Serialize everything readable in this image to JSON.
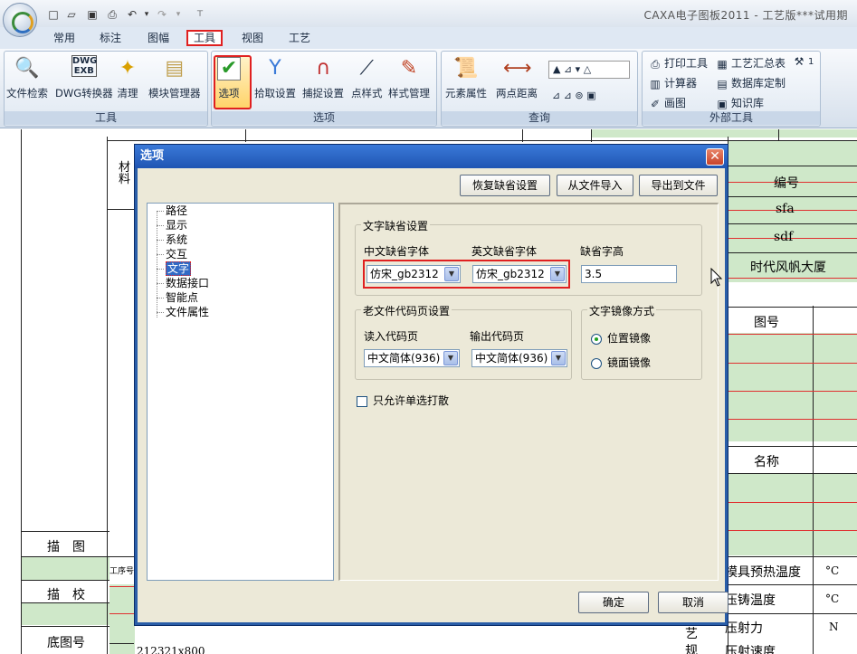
{
  "app": {
    "title": "CAXA电子图板2011 - 工艺版***试用期",
    "quick_access": [
      "□",
      "▱",
      "▣",
      "⎙",
      "↶",
      "▾",
      "↷",
      "▾",
      "⊤"
    ]
  },
  "ribbon_tabs": [
    "常用",
    "标注",
    "图幅",
    "工具",
    "视图",
    "工艺"
  ],
  "groups": {
    "tools": {
      "label": "工具",
      "buttons": [
        {
          "label": "文件检索",
          "icon": "search-icon"
        },
        {
          "label": "DWG转换器",
          "icon": "dwg-converter-icon"
        },
        {
          "label": "清理",
          "icon": "clean-icon"
        },
        {
          "label": "模块管理器",
          "icon": "module-manager-icon"
        }
      ]
    },
    "options": {
      "label": "选项",
      "buttons": [
        {
          "label": "选项",
          "icon": "checkmark-icon"
        },
        {
          "label": "拾取设置",
          "icon": "pick-icon"
        },
        {
          "label": "捕捉设置",
          "icon": "magnet-icon"
        },
        {
          "label": "点样式",
          "icon": "point-style-icon"
        },
        {
          "label": "样式管理",
          "icon": "style-manager-icon"
        }
      ]
    },
    "query": {
      "label": "查询",
      "buttons": [
        {
          "label": "元素属性",
          "icon": "properties-icon"
        },
        {
          "label": "两点距离",
          "icon": "distance-icon"
        }
      ]
    },
    "external": {
      "label": "外部工具",
      "buttons": [
        {
          "label": "打印工具",
          "icon": "printer-icon"
        },
        {
          "label": "工艺汇总表",
          "icon": "summary-table-icon"
        },
        {
          "label": "1",
          "icon": "hammer-icon"
        },
        {
          "label": "计算器",
          "icon": "calculator-icon"
        },
        {
          "label": "数据库定制",
          "icon": "database-icon"
        },
        {
          "label": "画图",
          "icon": "paint-icon"
        },
        {
          "label": "知识库",
          "icon": "knowledge-icon"
        }
      ]
    }
  },
  "drawing": {
    "labels": [
      "材料",
      "编号",
      "sfa",
      "sdf",
      "时代风帆大厦",
      "图号",
      "名称",
      "描　图",
      "描　校",
      "底图号",
      "工序号",
      "模具预热温度",
      "压铸温度",
      "压射力",
      "°C",
      "°C",
      "N",
      "212321x800",
      "压射速度",
      "艺",
      "规"
    ]
  },
  "dialog": {
    "title": "选项",
    "buttons": {
      "restore": "恢复缺省设置",
      "import": "从文件导入",
      "export": "导出到文件",
      "ok": "确定",
      "cancel": "取消"
    },
    "tree": [
      "路径",
      "显示",
      "系统",
      "交互",
      "文字",
      "数据接口",
      "智能点",
      "文件属性"
    ],
    "text_defaults": {
      "legend": "文字缺省设置",
      "cn_font_label": "中文缺省字体",
      "cn_font_value": "仿宋_gb2312",
      "en_font_label": "英文缺省字体",
      "en_font_value": "仿宋_gb2312",
      "height_label": "缺省字高",
      "height_value": "3.5"
    },
    "code_page": {
      "legend": "老文件代码页设置",
      "read_label": "读入代码页",
      "read_value": "中文简体(936)",
      "output_label": "输出代码页",
      "output_value": "中文简体(936)"
    },
    "mirror": {
      "legend": "文字镜像方式",
      "position": "位置镜像",
      "mirror": "镜面镜像",
      "selected": "position"
    },
    "single_select_label": "只允许单选打散"
  },
  "colors": {
    "accent": "#e02020",
    "dialog_frame": "#2a5ea8",
    "selection": "#316ac5",
    "grid_green": "#cfe8c9"
  }
}
